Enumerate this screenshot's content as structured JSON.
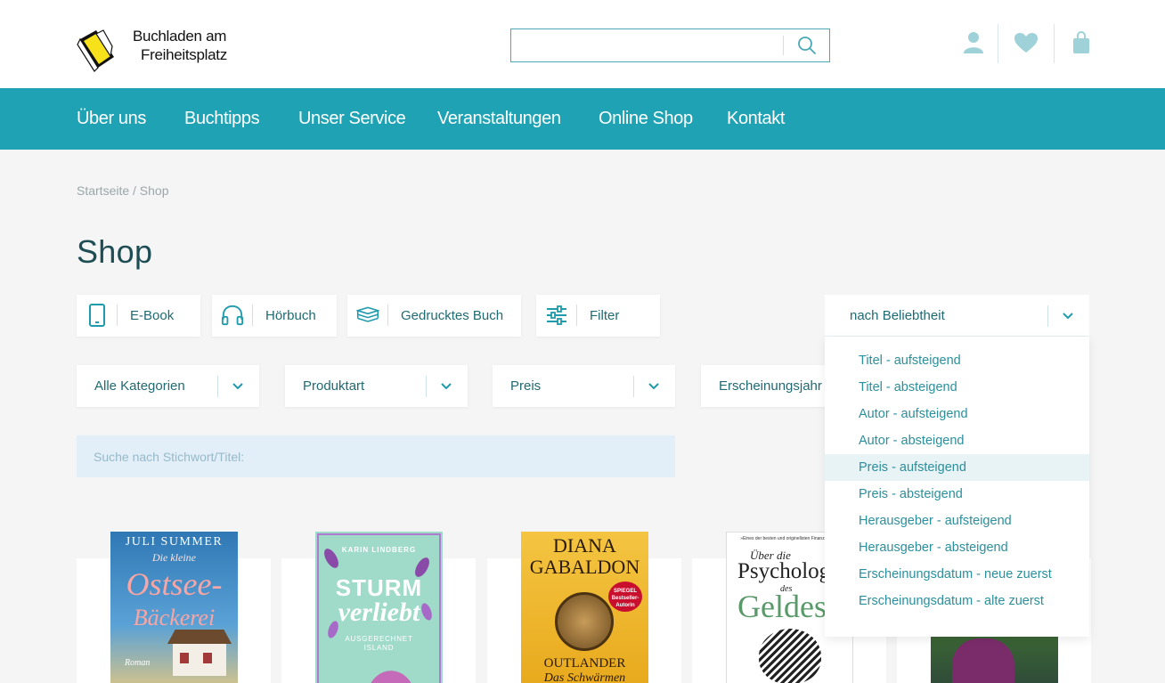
{
  "header": {
    "logo_line1": "Buchladen am",
    "logo_line2": "Freiheitsplatz",
    "search_value": ""
  },
  "nav": {
    "items": [
      "Über uns",
      "Buchtipps",
      "Unser Service",
      "Veranstaltungen",
      "Online Shop",
      "Kontakt"
    ]
  },
  "breadcrumb": "Startseite / Shop",
  "page_title": "Shop",
  "format_buttons": [
    "E-Book",
    "Hörbuch",
    "Gedrucktes Buch",
    "Filter"
  ],
  "selects": [
    "Alle Kategorien",
    "Produktart",
    "Preis",
    "Erscheinungsjahr"
  ],
  "keyword_placeholder": "Suche nach Stichwort/Titel:",
  "sort": {
    "selected": "nach Beliebtheit",
    "options": [
      "Titel - aufsteigend",
      "Titel - absteigend",
      "Autor - aufsteigend",
      "Autor - absteigend",
      "Preis - aufsteigend",
      "Preis - absteigend",
      "Herausgeber - aufsteigend",
      "Herausgeber - absteigend",
      "Erscheinungsdatum - neue zuerst",
      "Erscheinungsdatum - alte zuerst"
    ],
    "highlighted_index": 4
  },
  "books": [
    {
      "author": "JULI SUMMER",
      "subtitle": "Die kleine",
      "title1": "Ostsee-",
      "title2": "Bäckerei",
      "genre": "Roman"
    },
    {
      "author": "KARIN LINDBERG",
      "title1": "STURM",
      "title2": "verliebt",
      "subtitle": "AUSGERECHNET ISLAND"
    },
    {
      "author": "DIANA GABALDON",
      "badge": "SPIEGEL Bestseller-Autorin",
      "title1": "OUTLANDER",
      "title2": "Das Schwärmen"
    },
    {
      "blurb": "»Eines der besten und originellsten Finanzbücher«",
      "title1": "Über die",
      "title2": "Psycholog",
      "title3": "des",
      "title4": "Geldes"
    },
    {}
  ],
  "colors": {
    "accent": "#1fa3b4",
    "text": "#1f6a73",
    "bg": "#f5f5f5"
  }
}
